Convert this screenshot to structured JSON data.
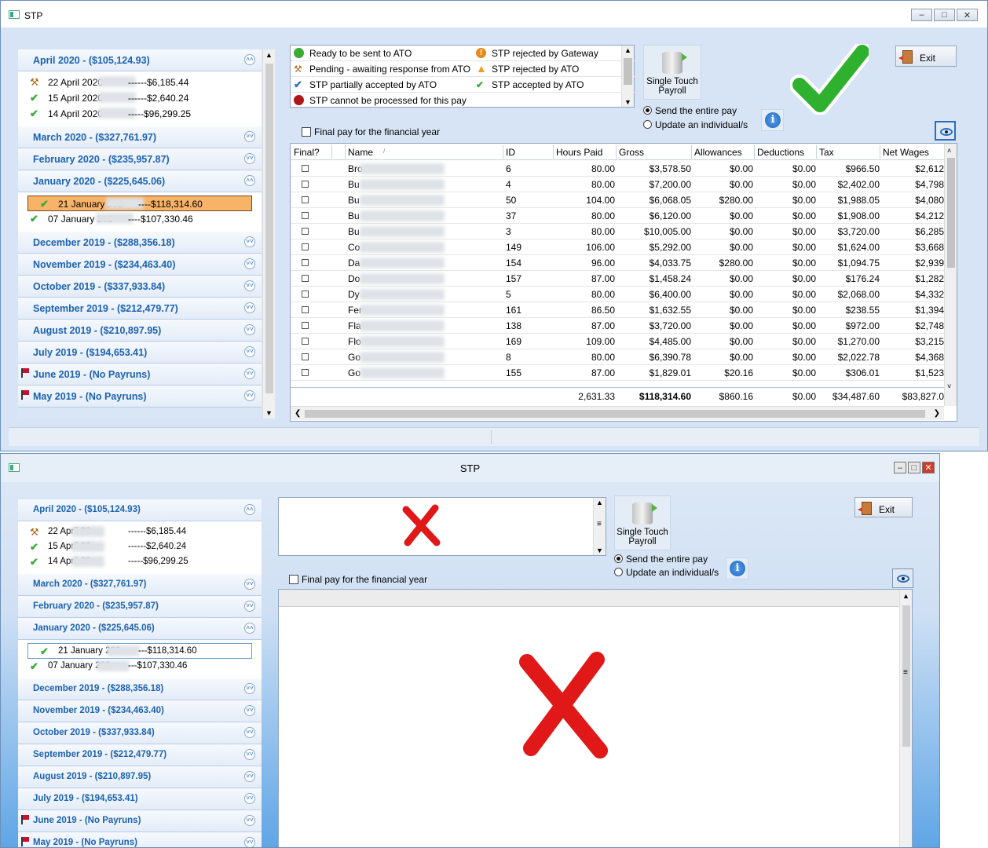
{
  "windows": [
    {
      "title": "STP",
      "sidebar": [
        {
          "label": "April 2020  -  ($105,124.93)",
          "expanded": true,
          "items": [
            {
              "icon": "tools-icon",
              "date": "22 April 2020",
              "amount": "------$6,185.44"
            },
            {
              "icon": "check-icon",
              "date": "15 April 2020",
              "amount": "------$2,640.24"
            },
            {
              "icon": "check-icon",
              "date": "14 April 2020",
              "amount": "-----$96,299.25"
            }
          ]
        },
        {
          "label": "March 2020  -  ($327,761.97)",
          "expanded": false
        },
        {
          "label": "February 2020  -  ($235,957.87)",
          "expanded": false
        },
        {
          "label": "January 2020  -  ($225,645.06)",
          "expanded": true,
          "items": [
            {
              "icon": "check-icon",
              "date": "21 January 202",
              "amount": "----$118,314.60",
              "selected": true
            },
            {
              "icon": "check-icon",
              "date": "07 January 202",
              "amount": "----$107,330.46"
            }
          ]
        },
        {
          "label": "December 2019  -  ($288,356.18)",
          "expanded": false
        },
        {
          "label": "November 2019  -  ($234,463.40)",
          "expanded": false
        },
        {
          "label": "October 2019  -  ($337,933.84)",
          "expanded": false
        },
        {
          "label": "September 2019  -  ($212,479.77)",
          "expanded": false
        },
        {
          "label": "August 2019  -  ($210,897.95)",
          "expanded": false
        },
        {
          "label": "July 2019  -  ($194,653.41)",
          "expanded": false
        },
        {
          "label": "June 2019  -  (No Payruns)",
          "expanded": false,
          "flag": true
        },
        {
          "label": "May 2019  -  (No Payruns)",
          "expanded": false,
          "flag": true
        }
      ],
      "legend": [
        {
          "icon": "green-dot-icon",
          "color": "#3aaa35",
          "text": "Ready to be sent to ATO"
        },
        {
          "icon": "orange-exclaim-icon",
          "color": "#e8891a",
          "text": "STP rejected by Gateway"
        },
        {
          "icon": "tools-icon",
          "color": "#c07020",
          "text": "Pending - awaiting response from ATO"
        },
        {
          "icon": "warning-icon",
          "color": "#f0a020",
          "text": "STP rejected by ATO"
        },
        {
          "icon": "blue-check-icon",
          "color": "#2a6fc0",
          "text": "STP partially accepted by ATO"
        },
        {
          "icon": "check-icon",
          "color": "#3aaa35",
          "text": "STP accepted by ATO"
        },
        {
          "icon": "red-dot-icon",
          "color": "#b01818",
          "text": "STP cannot be processed for this pay"
        }
      ],
      "stp_button": "Single Touch\nPayroll",
      "radio_entire": "Send the entire pay",
      "radio_individual": "Update an individual/s",
      "exit_label": "Exit",
      "final_pay_label": "Final pay for the financial year",
      "columns": [
        "Final?",
        "Name",
        "ID",
        "Hours Paid",
        "Gross",
        "Allowances",
        "Deductions",
        "Tax",
        "Net Wages"
      ],
      "rows": [
        {
          "name": "Bro",
          "id": "6",
          "hours": "80.00",
          "gross": "$3,578.50",
          "allow": "$0.00",
          "deduct": "$0.00",
          "tax": "$966.50",
          "net": "$2,612"
        },
        {
          "name": "Bu",
          "id": "4",
          "hours": "80.00",
          "gross": "$7,200.00",
          "allow": "$0.00",
          "deduct": "$0.00",
          "tax": "$2,402.00",
          "net": "$4,798"
        },
        {
          "name": "Bu",
          "id": "50",
          "hours": "104.00",
          "gross": "$6,068.05",
          "allow": "$280.00",
          "deduct": "$0.00",
          "tax": "$1,988.05",
          "net": "$4,080"
        },
        {
          "name": "Bu",
          "id": "37",
          "hours": "80.00",
          "gross": "$6,120.00",
          "allow": "$0.00",
          "deduct": "$0.00",
          "tax": "$1,908.00",
          "net": "$4,212"
        },
        {
          "name": "Bu",
          "id": "3",
          "hours": "80.00",
          "gross": "$10,005.00",
          "allow": "$0.00",
          "deduct": "$0.00",
          "tax": "$3,720.00",
          "net": "$6,285"
        },
        {
          "name": "Co",
          "id": "149",
          "hours": "106.00",
          "gross": "$5,292.00",
          "allow": "$0.00",
          "deduct": "$0.00",
          "tax": "$1,624.00",
          "net": "$3,668"
        },
        {
          "name": "Da",
          "id": "154",
          "hours": "96.00",
          "gross": "$4,033.75",
          "allow": "$280.00",
          "deduct": "$0.00",
          "tax": "$1,094.75",
          "net": "$2,939"
        },
        {
          "name": "Do",
          "id": "157",
          "hours": "87.00",
          "gross": "$1,458.24",
          "allow": "$0.00",
          "deduct": "$0.00",
          "tax": "$176.24",
          "net": "$1,282"
        },
        {
          "name": "Dy",
          "id": "5",
          "hours": "80.00",
          "gross": "$6,400.00",
          "allow": "$0.00",
          "deduct": "$0.00",
          "tax": "$2,068.00",
          "net": "$4,332"
        },
        {
          "name": "Fer",
          "id": "161",
          "hours": "86.50",
          "gross": "$1,632.55",
          "allow": "$0.00",
          "deduct": "$0.00",
          "tax": "$238.55",
          "net": "$1,394"
        },
        {
          "name": "Fla",
          "id": "138",
          "hours": "87.00",
          "gross": "$3,720.00",
          "allow": "$0.00",
          "deduct": "$0.00",
          "tax": "$972.00",
          "net": "$2,748"
        },
        {
          "name": "Flo",
          "id": "169",
          "hours": "109.00",
          "gross": "$4,485.00",
          "allow": "$0.00",
          "deduct": "$0.00",
          "tax": "$1,270.00",
          "net": "$3,215"
        },
        {
          "name": "Go",
          "id": "8",
          "hours": "80.00",
          "gross": "$6,390.78",
          "allow": "$0.00",
          "deduct": "$0.00",
          "tax": "$2,022.78",
          "net": "$4,368"
        },
        {
          "name": "Go",
          "id": "155",
          "hours": "87.00",
          "gross": "$1,829.01",
          "allow": "$20.16",
          "deduct": "$0.00",
          "tax": "$306.01",
          "net": "$1,523"
        }
      ],
      "totals": {
        "hours": "2,631.33",
        "gross": "$118,314.60",
        "allow": "$860.16",
        "deduct": "$0.00",
        "tax": "$34,487.60",
        "net": "$83,827.0"
      }
    },
    {
      "title": "STP",
      "sidebar": [
        {
          "label": "April 2020  -  ($105,124.93)",
          "expanded": true,
          "items": [
            {
              "icon": "tools-icon",
              "date": "22 April 20",
              "amount": "------$6,185.44"
            },
            {
              "icon": "check-icon",
              "date": "15 April 20",
              "amount": "------$2,640.24"
            },
            {
              "icon": "check-icon",
              "date": "14 April 20",
              "amount": "-----$96,299.25"
            }
          ]
        },
        {
          "label": "March 2020  -  ($327,761.97)",
          "expanded": false
        },
        {
          "label": "February 2020  -  ($235,957.87)",
          "expanded": false
        },
        {
          "label": "January 2020  -  ($225,645.06)",
          "expanded": true,
          "items": [
            {
              "icon": "check-icon",
              "date": "21 January 202",
              "amount": "---$118,314.60",
              "selected": true
            },
            {
              "icon": "check-icon",
              "date": "07 January 202",
              "amount": "---$107,330.46"
            }
          ]
        },
        {
          "label": "December 2019  -  ($288,356.18)",
          "expanded": false
        },
        {
          "label": "November 2019  -  ($234,463.40)",
          "expanded": false
        },
        {
          "label": "October 2019  -  ($337,933.84)",
          "expanded": false
        },
        {
          "label": "September 2019  -  ($212,479.77)",
          "expanded": false
        },
        {
          "label": "August 2019  -  ($210,897.95)",
          "expanded": false
        },
        {
          "label": "July 2019  -  ($194,653.41)",
          "expanded": false
        },
        {
          "label": "June 2019  -  (No Payruns)",
          "expanded": false,
          "flag": true
        },
        {
          "label": "May 2019  -  (No Payruns)",
          "expanded": false,
          "flag": true
        }
      ],
      "stp_button": "Single Touch\nPayroll",
      "radio_entire": "Send the entire pay",
      "radio_individual": "Update an individual/s",
      "exit_label": "Exit",
      "final_pay_label": "Final pay for the financial year"
    }
  ],
  "colors": {
    "accent": "#1c62b1",
    "good": "#2fb12f",
    "bad": "#e01818",
    "selected": "#f7b468"
  }
}
